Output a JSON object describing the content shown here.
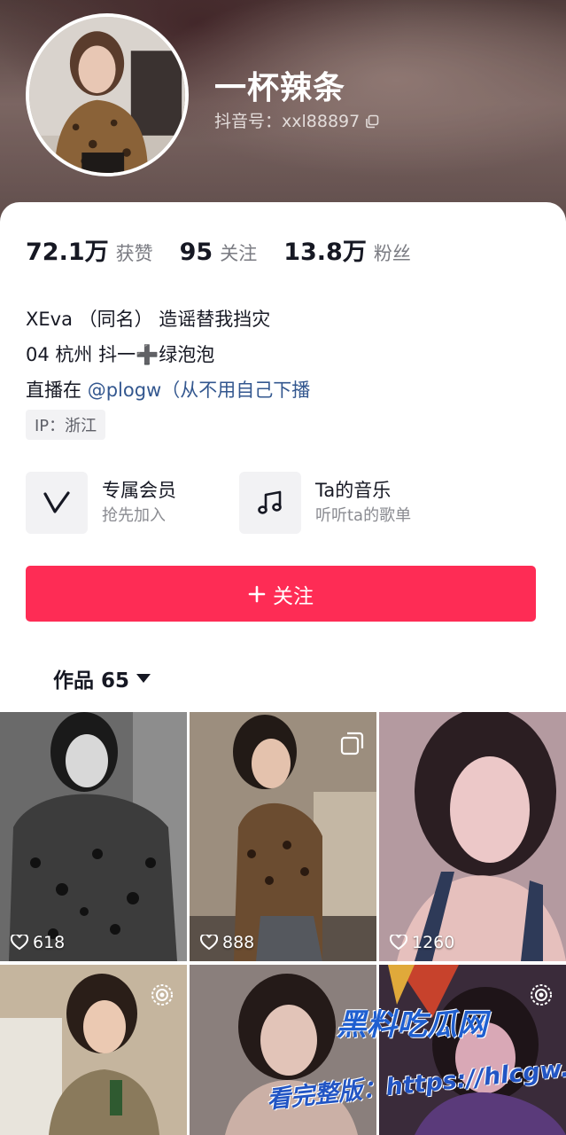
{
  "profile": {
    "username": "一杯辣条",
    "douyin_id": "抖音号：xxl88897",
    "stats": [
      {
        "value": "72.1万",
        "label": "获赞"
      },
      {
        "value": "95",
        "label": "关注"
      },
      {
        "value": "13.8万",
        "label": "粉丝"
      }
    ],
    "bio": {
      "line1": "XEva （同名） 造谣替我挡灾",
      "line2": "04 杭州 抖一➕绿泡泡",
      "line3_prefix": "直播在 ",
      "line3_mention": "@plogw（从不用自己下播"
    },
    "ip": "IP：浙江"
  },
  "features": [
    {
      "title": "专属会员",
      "subtitle": "抢先加入",
      "icon": "v-badge-icon"
    },
    {
      "title": "Ta的音乐",
      "subtitle": "听听ta的歌单",
      "icon": "music-note-icon"
    }
  ],
  "follow_button": {
    "label": "关注",
    "color": "#fe2c55"
  },
  "works_tab": {
    "label": "作品 65"
  },
  "videos": [
    {
      "likes": "618",
      "badge": ""
    },
    {
      "likes": "888",
      "badge": "multi-image-icon"
    },
    {
      "likes": "1260",
      "badge": ""
    },
    {
      "likes": "",
      "badge": "live-icon"
    },
    {
      "likes": "",
      "badge": ""
    },
    {
      "likes": "",
      "badge": "live-icon"
    }
  ],
  "watermark": {
    "line1": "黑料吃瓜网",
    "line2": "看完整版：https://hlcgw.net"
  }
}
